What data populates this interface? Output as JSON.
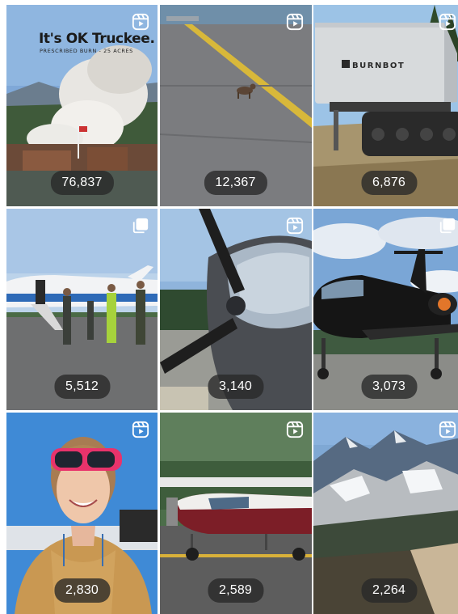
{
  "grid": {
    "tiles": [
      {
        "views": "76,837",
        "badge": "reel-icon",
        "overlay_title": "It's OK Truckee.",
        "overlay_subtitle": "PRESCRIBED BURN - 25 ACRES"
      },
      {
        "views": "12,367",
        "badge": "reel-icon"
      },
      {
        "views": "6,876",
        "badge": "reel-icon",
        "brand": "BURNBOT"
      },
      {
        "views": "5,512",
        "badge": "carousel-icon"
      },
      {
        "views": "3,140",
        "badge": "reel-icon"
      },
      {
        "views": "3,073",
        "badge": "carousel-icon"
      },
      {
        "views": "2,830",
        "badge": "reel-icon"
      },
      {
        "views": "2,589",
        "badge": "reel-icon"
      },
      {
        "views": "2,264",
        "badge": "reel-icon"
      }
    ]
  },
  "colors": {
    "pill_bg": "#2b2b2b",
    "pill_text": "#ffffff",
    "badge": "#ffffff"
  }
}
